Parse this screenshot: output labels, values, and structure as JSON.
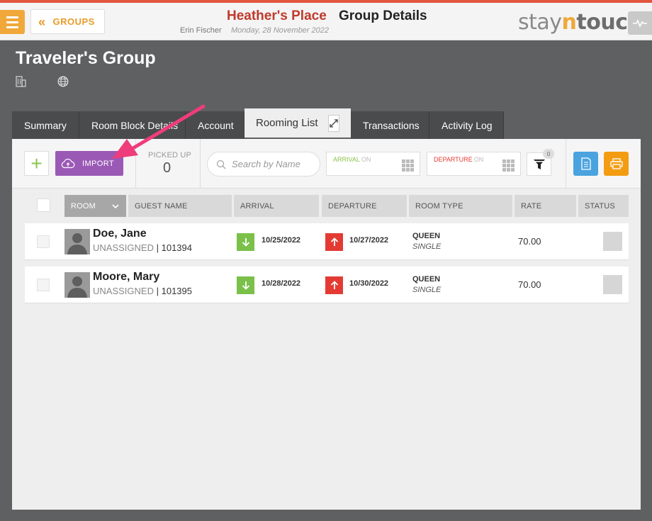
{
  "header": {
    "groups_label": "GROUPS",
    "hotel_name": "Heather's Place",
    "page_title": "Group Details",
    "user_name": "Erin Fischer",
    "date": "Monday, 28 November 2022",
    "logo": {
      "part1": "stay",
      "part2": "n",
      "part3": "touch"
    }
  },
  "group": {
    "title": "Traveler's Group"
  },
  "tabs": [
    {
      "label": "Summary"
    },
    {
      "label": "Room Block Details"
    },
    {
      "label": "Account"
    },
    {
      "label": "Rooming List"
    },
    {
      "label": "Transactions"
    },
    {
      "label": "Activity Log"
    }
  ],
  "toolbar": {
    "import_label": "IMPORT",
    "picked_up_label": "PICKED UP",
    "picked_up_value": "0",
    "search_placeholder": "Search by Name",
    "arrival_label": "ARRIVAL",
    "departure_label": "DEPARTURE",
    "on_label": "ON",
    "filter_badge": "0"
  },
  "table": {
    "columns": [
      "ROOM",
      "GUEST NAME",
      "ARRIVAL",
      "DEPARTURE",
      "ROOM TYPE",
      "RATE",
      "STATUS"
    ],
    "rows": [
      {
        "name": "Doe, Jane",
        "assignment": "UNASSIGNED",
        "id": "101394",
        "arrival": "10/25/2022",
        "departure": "10/27/2022",
        "room_type": "QUEEN",
        "room_sub": "SINGLE",
        "rate": "70.00"
      },
      {
        "name": "Moore, Mary",
        "assignment": "UNASSIGNED",
        "id": "101395",
        "arrival": "10/28/2022",
        "departure": "10/30/2022",
        "room_type": "QUEEN",
        "room_sub": "SINGLE",
        "rate": "70.00"
      }
    ]
  },
  "colors": {
    "accent": "#f0a83a",
    "hotel": "#c0392b",
    "import": "#9b59b6",
    "arrival": "#7bc04a",
    "departure": "#e33b34",
    "annotation": "#ee3d7a"
  }
}
